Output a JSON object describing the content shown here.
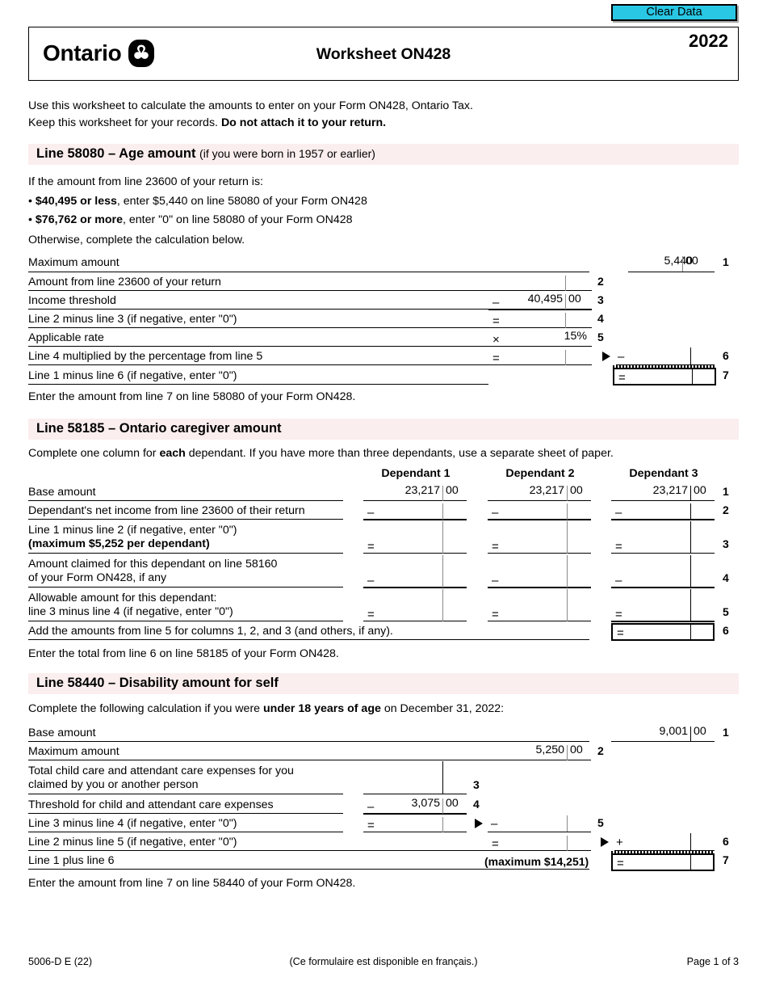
{
  "toolbar": {
    "clear_data_label": "Clear Data"
  },
  "header": {
    "province": "Ontario",
    "logo_icon": "ontario-trillium-icon",
    "title": "Worksheet ON428",
    "year": "2022"
  },
  "intro": {
    "line1": "Use this worksheet to calculate the amounts to enter on your Form ON428, Ontario Tax.",
    "line2_plain": "Keep this worksheet for your records. ",
    "line2_bold": "Do not attach it to your return."
  },
  "sections": [
    {
      "id": "age-amount",
      "heading_bold": "Line 58080 – Age amount",
      "heading_sub": "(if you were born in 1957 or earlier)",
      "lead": "If the amount from line 23600 of your return is:",
      "bullets": [
        {
          "bold": "$40,495 or less",
          "rest": ", enter $5,440 on line 58080 of your Form ON428"
        },
        {
          "bold": "$76,762 or more",
          "rest": ", enter \"0\" on line 58080 of your Form ON428"
        }
      ],
      "otherwise": "Otherwise, complete the calculation below.",
      "rows": [
        {
          "idx": "1",
          "desc": "Maximum amount",
          "value": "5,440",
          "cents": "00"
        },
        {
          "idx": "2",
          "desc": "Amount from line 23600 of your return",
          "value": "",
          "cents": ""
        },
        {
          "idx": "3",
          "desc": "Income threshold",
          "op": "–",
          "value": "40,495",
          "cents": "00"
        },
        {
          "idx": "4",
          "desc": "Line 2 minus line 3 (if negative, enter \"0\")",
          "op": "=",
          "value": "",
          "cents": ""
        },
        {
          "idx": "5",
          "desc": "Applicable rate",
          "op": "×",
          "value": "15%",
          "cents": ""
        },
        {
          "idx": "6",
          "desc": "Line 4 multiplied by the percentage from line 5",
          "op": "=",
          "carry_op": "–",
          "value": "",
          "cents": ""
        },
        {
          "idx": "7",
          "desc": "Line 1 minus line 6 (if negative, enter \"0\")",
          "op": "=",
          "boxed": true,
          "value": "",
          "cents": ""
        }
      ],
      "closing": "Enter the amount from line 7 on line 58080 of your Form ON428."
    },
    {
      "id": "caregiver-amount",
      "heading_bold": "Line 58185 – Ontario caregiver amount",
      "heading_sub": "",
      "instruction_a": "Complete one column for ",
      "instruction_bold": "each",
      "instruction_b": " dependant. If you have more than three dependants, use a separate sheet of paper.",
      "column_headers": [
        "Dependant 1",
        "Dependant 2",
        "Dependant 3"
      ],
      "rows": [
        {
          "idx": "1",
          "desc": "Base amount",
          "values": [
            "23,217",
            "23,217",
            "23,217"
          ],
          "cents": [
            "00",
            "00",
            "00"
          ]
        },
        {
          "idx": "2",
          "desc": "Dependant's net income from line 23600 of their return",
          "op": "–",
          "values": [
            "",
            "",
            ""
          ]
        },
        {
          "idx": "3",
          "desc_line1": "Line 1 minus line 2 (if negative, enter \"0\")",
          "desc_line2": "(maximum $5,252 per dependant)",
          "op": "=",
          "values": [
            "",
            "",
            ""
          ]
        },
        {
          "idx": "4",
          "desc_line1": "Amount claimed for this dependant on line 58160",
          "desc_line2": "of your Form ON428, if any",
          "op": "–",
          "values": [
            "",
            "",
            ""
          ]
        },
        {
          "idx": "5",
          "desc_line1": "Allowable amount for this dependant:",
          "desc_line2": "line 3 minus line 4 (if negative, enter \"0\")",
          "op": "=",
          "values": [
            "",
            "",
            ""
          ]
        },
        {
          "idx": "6",
          "desc": "Add the amounts from line 5 for columns 1, 2, and 3 (and others, if any).",
          "op": "=",
          "boxed": true
        }
      ],
      "closing": "Enter the total from line 6 on line 58185 of your Form ON428."
    },
    {
      "id": "disability-amount",
      "heading_bold": "Line 58440 – Disability amount for self",
      "heading_sub": "",
      "instruction_a": "Complete the following calculation if you were ",
      "instruction_bold": "under 18 years of age",
      "instruction_b": " on December 31, 2022:",
      "rows": [
        {
          "idx": "1",
          "desc": "Base amount",
          "value": "9,001",
          "cents": "00"
        },
        {
          "idx": "2",
          "desc": "Maximum amount",
          "value": "5,250",
          "cents": "00"
        },
        {
          "idx": "3",
          "desc_line1": "Total child care and attendant care expenses for you",
          "desc_line2": "claimed by you or another person",
          "value": "",
          "cents": ""
        },
        {
          "idx": "4",
          "desc": "Threshold for child and attendant care expenses",
          "op": "–",
          "value": "3,075",
          "cents": "00"
        },
        {
          "idx": "5",
          "desc": "Line 3 minus line 4 (if negative, enter \"0\")",
          "op": "=",
          "carry_op": "–",
          "value": "",
          "cents": ""
        },
        {
          "idx": "6",
          "desc": "Line 2 minus line 5 (if negative, enter \"0\")",
          "op": "=",
          "carry_op": "+",
          "value": "",
          "cents": ""
        },
        {
          "idx": "7",
          "desc": "Line 1 plus line 6",
          "maximum_note": "(maximum $14,251)",
          "boxed": true,
          "value": "",
          "cents": ""
        }
      ],
      "closing": "Enter the amount from line 7 on line 58440 of your Form ON428."
    }
  ],
  "footer": {
    "form_code": "5006-D E (22)",
    "french_note": "(Ce formulaire est disponible en français.)",
    "page": "Page 1 of 3"
  },
  "colors": {
    "section_header_bg": "#fbeeee",
    "clear_data_bg": "#29c7e4",
    "rule": "#000000"
  }
}
